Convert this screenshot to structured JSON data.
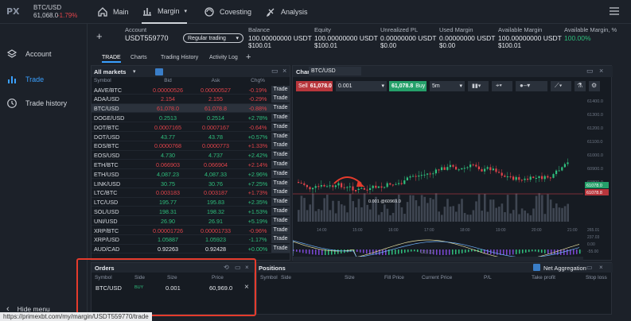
{
  "topbar": {
    "ticker_symbol": "BTC/USD",
    "ticker_price": "61,068.0",
    "ticker_change": "-1.79%",
    "nav": [
      {
        "label": "Main"
      },
      {
        "label": "Margin"
      },
      {
        "label": "Covesting"
      },
      {
        "label": "Analysis"
      }
    ]
  },
  "sidebar": {
    "items": [
      {
        "label": "Account"
      },
      {
        "label": "Trade"
      },
      {
        "label": "Trade history"
      }
    ],
    "hide_menu": "Hide menu"
  },
  "account": {
    "label": "Account",
    "id": "USDT559770",
    "mode": "Regular trading",
    "fields": [
      {
        "label": "Balance",
        "value": "100.00000000 USDT",
        "sub": "$100.01"
      },
      {
        "label": "Equity",
        "value": "100.00000000 USDT",
        "sub": "$100.01"
      },
      {
        "label": "Unrealized PL",
        "value": "0.00000000 USDT",
        "sub": "$0.00"
      },
      {
        "label": "Used Margin",
        "value": "0.00000000 USDT",
        "sub": "$0.00"
      },
      {
        "label": "Available Margin",
        "value": "100.00000000 USDT",
        "sub": "$100.01"
      },
      {
        "label": "Available Margin, %",
        "value": "100.00%",
        "sub": ""
      }
    ]
  },
  "tabs": [
    "TRADE",
    "Charts",
    "Trading History",
    "Activity Log"
  ],
  "markets": {
    "title": "All markets",
    "columns": [
      "Symbol",
      "Bid",
      "Ask",
      "Chg%"
    ],
    "trade_label": "Trade",
    "rows": [
      {
        "symbol": "AAVE/BTC",
        "bid": "0.00000526",
        "ask": "0.00000527",
        "chg": "-0.19%",
        "dir": "dn"
      },
      {
        "symbol": "ADA/USD",
        "bid": "2.154",
        "ask": "2.155",
        "chg": "-0.29%",
        "dir": "dn"
      },
      {
        "symbol": "BTC/USD",
        "bid": "61,078.0",
        "ask": "61,078.8",
        "chg": "-0.88%",
        "dir": "dn"
      },
      {
        "symbol": "DOGE/USD",
        "bid": "0.2513",
        "ask": "0.2514",
        "chg": "+2.78%",
        "dir": "up"
      },
      {
        "symbol": "DOT/BTC",
        "bid": "0.0007165",
        "ask": "0.0007167",
        "chg": "-0.64%",
        "dir": "dn"
      },
      {
        "symbol": "DOT/USD",
        "bid": "43.77",
        "ask": "43.78",
        "chg": "+0.57%",
        "dir": "up"
      },
      {
        "symbol": "EOS/BTC",
        "bid": "0.0000768",
        "ask": "0.0000773",
        "chg": "+1.33%",
        "dir": "dn"
      },
      {
        "symbol": "EOS/USD",
        "bid": "4.730",
        "ask": "4.737",
        "chg": "+2.42%",
        "dir": "up"
      },
      {
        "symbol": "ETH/BTC",
        "bid": "0.066903",
        "ask": "0.066904",
        "chg": "+2.14%",
        "dir": "dn"
      },
      {
        "symbol": "ETH/USD",
        "bid": "4,087.23",
        "ask": "4,087.33",
        "chg": "+2.96%",
        "dir": "up"
      },
      {
        "symbol": "LINK/USD",
        "bid": "30.75",
        "ask": "30.76",
        "chg": "+7.25%",
        "dir": "up"
      },
      {
        "symbol": "LTC/BTC",
        "bid": "0.003183",
        "ask": "0.003187",
        "chg": "+1.73%",
        "dir": "dn"
      },
      {
        "symbol": "LTC/USD",
        "bid": "195.77",
        "ask": "195.83",
        "chg": "+2.35%",
        "dir": "up"
      },
      {
        "symbol": "SOL/USD",
        "bid": "198.31",
        "ask": "198.32",
        "chg": "+1.53%",
        "dir": "up"
      },
      {
        "symbol": "UNI/USD",
        "bid": "26.90",
        "ask": "26.91",
        "chg": "+5.19%",
        "dir": "up"
      },
      {
        "symbol": "XRP/BTC",
        "bid": "0.00001726",
        "ask": "0.00001733",
        "chg": "-0.96%",
        "dir": "dn"
      },
      {
        "symbol": "XRP/USD",
        "bid": "1.05887",
        "ask": "1.05923",
        "chg": "-1.17%",
        "dir": "up"
      },
      {
        "symbol": "AUD/CAD",
        "bid": "0.92263",
        "ask": "0.92428",
        "chg": "+0.00%",
        "dir": "up"
      }
    ]
  },
  "chart": {
    "title": "Chart",
    "symbol": "BTC/USD",
    "sell_label": "Sell",
    "sell_price": "61,078.0",
    "qty": "0.001",
    "buy_price": "61,078.8",
    "buy_label": "Buy",
    "interval": "5m",
    "price_labels": [
      "61400.0",
      "61300.0",
      "61200.0",
      "61100.0",
      "61000.0",
      "60900.0",
      "60800.0"
    ],
    "tag_bid": "61078.0",
    "tag_ask": "61078.8",
    "order_line_label": "0.001 @60969.0",
    "time_labels": [
      "14:00",
      "15:00",
      "16:00",
      "17:00",
      "18:00",
      "19:00",
      "20:00",
      "21:00"
    ],
    "osc_labels": [
      "265.01",
      "237.03",
      "0.00",
      "-55.00"
    ],
    "date_label": "Oct 22"
  },
  "orders": {
    "title": "Orders",
    "columns": [
      "Symbol",
      "Side",
      "Size",
      "Price"
    ],
    "row": {
      "symbol": "BTC/USD",
      "side": "BUY",
      "size": "0.001",
      "price": "60,969.0"
    }
  },
  "positions": {
    "title": "Positions",
    "columns": [
      "Symbol",
      "Side",
      "Size",
      "Fill Price",
      "Current Price",
      "P/L",
      "Take profit",
      "Stop loss"
    ],
    "net_label": "Net Aggregation"
  },
  "status_url": "https://primexbt.com/my/margin/USDT559770/trade",
  "colors": {
    "buy": "#2fbf7d",
    "sell": "#e0434a",
    "accent": "#3aa0ff",
    "highlight": "#e53b2c"
  }
}
